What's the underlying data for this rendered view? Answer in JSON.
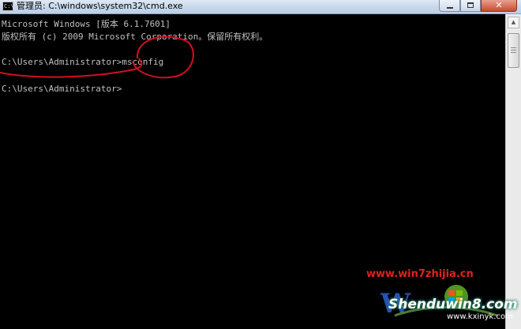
{
  "window": {
    "icon_label": "C:\\",
    "title": "管理员: C:\\windows\\system32\\cmd.exe",
    "close_glyph": "✕"
  },
  "console": {
    "lines": [
      "Microsoft Windows [版本 6.1.7601]",
      "版权所有 (c) 2009 Microsoft Corporation。保留所有权利。",
      "",
      "C:\\Users\\Administrator>msconfig",
      "",
      "C:\\Users\\Administrator>"
    ]
  },
  "scrollbar": {
    "up_arrow": "▲"
  },
  "watermark": {
    "url": "www.win7zhijia.cn",
    "brand": "Shenduwin8.com",
    "site": "www.kxinyk.com"
  },
  "colors": {
    "console_text": "#c0c0c0",
    "annotation": "#d0101f",
    "watermark_url": "#e02020"
  }
}
